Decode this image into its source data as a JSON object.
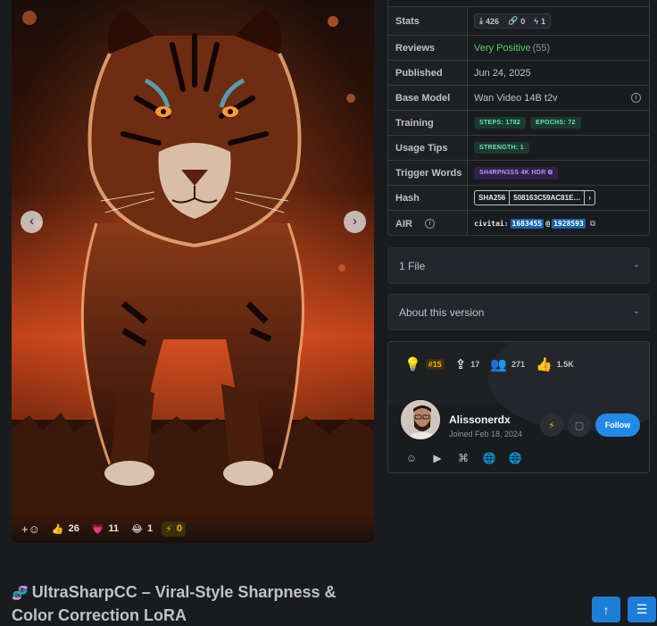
{
  "gallery": {
    "prev_icon": "chevron-left-icon",
    "next_icon": "chevron-right-icon",
    "reactions": [
      {
        "name": "thumbs-up",
        "emoji": "👍",
        "count": "26"
      },
      {
        "name": "heart",
        "emoji": "💗",
        "count": "11"
      },
      {
        "name": "laugh",
        "emoji": "😂",
        "count": "1"
      },
      {
        "name": "buzz",
        "emoji": "⚡",
        "count": "0"
      }
    ],
    "add_reaction": "+☺"
  },
  "model": {
    "title": "UltraSharpCC – Viral-Style Sharpness & Color Correction LoRA",
    "title_icon": "dna-icon"
  },
  "details": {
    "stats_label": "Stats",
    "stats": {
      "downloads": "426",
      "generations": "0",
      "buzz": "1"
    },
    "reviews_label": "Reviews",
    "reviews_value": "Very Positive",
    "reviews_count": "(55)",
    "published_label": "Published",
    "published_value": "Jun 24, 2025",
    "base_model_label": "Base Model",
    "base_model_value": "Wan Video 14B t2v",
    "training_label": "Training",
    "training_steps": "STEPS: 1782",
    "training_epochs": "EPOCHS: 72",
    "usage_label": "Usage Tips",
    "usage_strength": "STRENGTH: 1",
    "trigger_label": "Trigger Words",
    "trigger_value": "SH4RPN3SS 4K HDR",
    "hash_label": "Hash",
    "hash_type": "SHA256",
    "hash_value": "508163C59AC81E…",
    "air_label": "AIR",
    "air_prefix": "civitai:",
    "air_model": "1683455",
    "air_at": "@",
    "air_version": "1928593"
  },
  "accordions": {
    "files": "1 File",
    "about": "About this version"
  },
  "creator": {
    "rank": "#15",
    "uploads": "17",
    "followers": "271",
    "likes": "1.5K",
    "name": "Alissonerdx",
    "joined": "Joined Feb 18, 2024",
    "follow_label": "Follow",
    "socials": [
      "discord-icon",
      "youtube-icon",
      "github-icon",
      "globe-icon",
      "globe-icon"
    ]
  },
  "colors": {
    "accent": "#228be6",
    "positive": "#51cf66",
    "buzz": "#fab005",
    "background": "#1a1b1e"
  }
}
